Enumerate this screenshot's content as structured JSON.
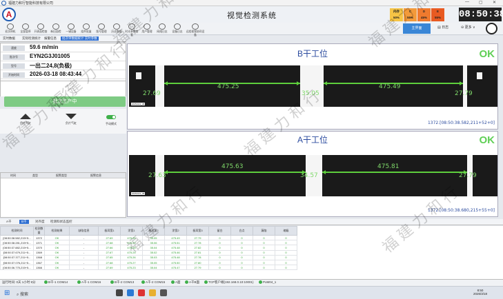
{
  "window": {
    "title": "福建力和行智能科技有限公司",
    "controls": [
      "—",
      "▢",
      "✕"
    ]
  },
  "app": {
    "logo": "A",
    "title": "视觉检测系统",
    "clock": "08:50:38",
    "stats": [
      {
        "label": "内存",
        "value": "50%",
        "color": "#f6c445"
      },
      {
        "label": "C",
        "value": "55%",
        "color": "#f39a3a"
      },
      {
        "label": "D",
        "value": "45%",
        "color": "#ef7a2e"
      },
      {
        "label": "E",
        "value": "55%",
        "color": "#e85a22"
      }
    ]
  },
  "toolbar": {
    "items": [
      "初次停机",
      "全部暂停",
      "开表面检查",
      "新旧面检",
      "一键设备",
      "组件批量",
      "版号管理",
      "历史数据",
      "时光参数查看",
      "用户管理",
      "网络日志",
      "设备日志",
      "远程视频协同设备"
    ],
    "main": "主界面",
    "log": "日志",
    "more": "更多"
  },
  "subtabs": [
    "实时数据",
    "实际检测统计",
    "报警信息",
    "批次单数据统计 实时参数"
  ],
  "info": [
    {
      "k": "速度",
      "v": "59.6 m/min"
    },
    {
      "k": "批次号",
      "v": "EYN2G3J01005"
    },
    {
      "k": "型号",
      "v": "一出二24,8(负极)"
    },
    {
      "k": "开始时间",
      "v": "2026-03-18 08:43:44"
    }
  ],
  "production": "批次生产中",
  "controls": [
    {
      "label": "负片气缸"
    },
    {
      "label": "负片气缸"
    },
    {
      "label": "手动模式"
    }
  ],
  "alarm": {
    "headers": [
      "时间",
      "类型",
      "报警类型",
      "报警信息"
    ]
  },
  "panels": [
    {
      "title": "B干工位",
      "status": "OK",
      "left": "27.69",
      "mid": "475.25",
      "center": "35.05",
      "right": "475.49",
      "edge": "27.79",
      "measure": "1372.[08:50:38.582,211+52+0]",
      "tag": "20251021_08"
    },
    {
      "title": "A干工位",
      "status": "OK",
      "left": "27.63",
      "mid": "475.63",
      "center": "34.57",
      "right": "475.81",
      "edge": "27.79",
      "measure": "1372.[08:50:38.680,215+55+0]",
      "tag": "20251021_08"
    }
  ],
  "bottomtabs": [
    "A干",
    "B干",
    "对齐度",
    "检测料状态监控"
  ],
  "table": {
    "headers": [
      "检测时间",
      "检测数量",
      "检测结果",
      "缺陷信息",
      "极耳宽1",
      "涂宽1",
      "极耳宽2",
      "涂宽2",
      "极耳宽3",
      "留白",
      "白点",
      "漏箔",
      "缩级"
    ],
    "rows": [
      [
        "[08:50:38.582,215+5...",
        "1372",
        "OK",
        "-",
        "27.69",
        "475.25",
        "35.05",
        "475.49",
        "27.79",
        "0",
        "0",
        "0",
        "0"
      ],
      [
        "[08:50:38.281,215+5...",
        "1371",
        "OK",
        "-",
        "27.68",
        "475.22",
        "35.06",
        "475.51",
        "27.78",
        "0",
        "0",
        "0",
        "0"
      ],
      [
        "[08:50:37.882,215+5...",
        "1370",
        "OK",
        "-",
        "27.66",
        "475.28",
        "35.04",
        "475.48",
        "27.82",
        "0",
        "0",
        "0",
        "0"
      ],
      [
        "[08:50:37.679,211+5...",
        "1369",
        "OK",
        "-",
        "27.67",
        "475.24",
        "35.02",
        "475.46",
        "27.81",
        "0",
        "0",
        "0",
        "0"
      ],
      [
        "[08:50:37.377,211+5...",
        "1368",
        "OK",
        "-",
        "27.65",
        "475.26",
        "35.03",
        "475.48",
        "27.78",
        "0",
        "0",
        "0",
        "0"
      ],
      [
        "[08:50:37.076,211+5...",
        "1367",
        "OK",
        "-",
        "27.68",
        "475.27",
        "35.05",
        "475.50",
        "27.80",
        "0",
        "0",
        "0",
        "0"
      ],
      [
        "[08:50:36.775,215+5...",
        "1366",
        "OK",
        "-",
        "27.69",
        "475.23",
        "35.04",
        "475.47",
        "27.79",
        "0",
        "0",
        "0",
        "0"
      ]
    ]
  },
  "status": {
    "runtime": "运行时间: 0天 1小时 9分",
    "items": [
      "B干-1 COM14",
      "A干-1 COM16",
      "B干-2 COM13",
      "A干-2 COM15",
      "A面",
      "A干B面",
      "TCP客户端(192.168.0.10:10001)",
      "PoM04_1"
    ]
  },
  "taskbar": {
    "search": "搜索",
    "time": "8:50",
    "date": "2026/3/18"
  },
  "watermark": "福建力和行"
}
